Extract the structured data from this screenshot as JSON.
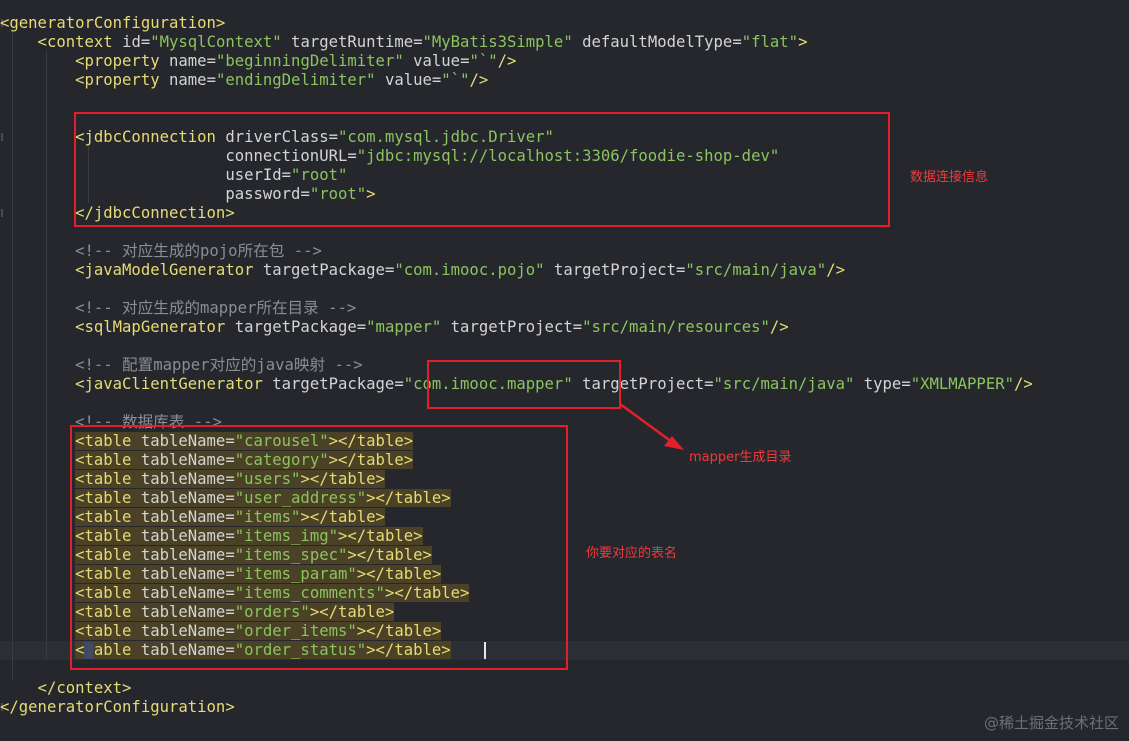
{
  "theme": {
    "tag": "#e6db74",
    "attr": "#d4d4d4",
    "value": "#8bc45e",
    "comment": "#8a8d94",
    "plain": "#d4d4d4",
    "highlight": "#4a4126",
    "annotation": "#e0212b"
  },
  "code_lines": [
    [
      {
        "t": "<generatorConfiguration>",
        "c": "tag"
      }
    ],
    [
      {
        "t": "    <context ",
        "c": "tag"
      },
      {
        "t": "id",
        "c": "attr"
      },
      {
        "t": "=",
        "c": "plain"
      },
      {
        "t": "\"MysqlContext\"",
        "c": "value"
      },
      {
        "t": " targetRuntime",
        "c": "attr"
      },
      {
        "t": "=",
        "c": "plain"
      },
      {
        "t": "\"MyBatis3Simple\"",
        "c": "value"
      },
      {
        "t": " defaultModelType",
        "c": "attr"
      },
      {
        "t": "=",
        "c": "plain"
      },
      {
        "t": "\"flat\"",
        "c": "value"
      },
      {
        "t": ">",
        "c": "tag"
      }
    ],
    [
      {
        "t": "        <property ",
        "c": "tag"
      },
      {
        "t": "name",
        "c": "attr"
      },
      {
        "t": "=",
        "c": "plain"
      },
      {
        "t": "\"beginningDelimiter\"",
        "c": "value"
      },
      {
        "t": " value",
        "c": "attr"
      },
      {
        "t": "=",
        "c": "plain"
      },
      {
        "t": "\"`\"",
        "c": "value"
      },
      {
        "t": "/>",
        "c": "tag"
      }
    ],
    [
      {
        "t": "        <property ",
        "c": "tag"
      },
      {
        "t": "name",
        "c": "attr"
      },
      {
        "t": "=",
        "c": "plain"
      },
      {
        "t": "\"endingDelimiter\"",
        "c": "value"
      },
      {
        "t": " value",
        "c": "attr"
      },
      {
        "t": "=",
        "c": "plain"
      },
      {
        "t": "\"`\"",
        "c": "value"
      },
      {
        "t": "/>",
        "c": "tag"
      }
    ],
    [],
    [],
    [
      {
        "t": "        <jdbcConnection ",
        "c": "tag"
      },
      {
        "t": "driverClass",
        "c": "attr"
      },
      {
        "t": "=",
        "c": "plain"
      },
      {
        "t": "\"com.mysql.jdbc.Driver\"",
        "c": "value"
      }
    ],
    [
      {
        "t": "                        connectionURL",
        "c": "attr"
      },
      {
        "t": "=",
        "c": "plain"
      },
      {
        "t": "\"jdbc:mysql://localhost:3306/foodie-shop-dev\"",
        "c": "value"
      }
    ],
    [
      {
        "t": "                        userId",
        "c": "attr"
      },
      {
        "t": "=",
        "c": "plain"
      },
      {
        "t": "\"root\"",
        "c": "value"
      }
    ],
    [
      {
        "t": "                        password",
        "c": "attr"
      },
      {
        "t": "=",
        "c": "plain"
      },
      {
        "t": "\"root\"",
        "c": "value"
      },
      {
        "t": ">",
        "c": "tag"
      }
    ],
    [
      {
        "t": "        </jdbcConnection>",
        "c": "tag"
      }
    ],
    [],
    [
      {
        "t": "        <!-- 对应生成的pojo所在包 -->",
        "c": "comment"
      }
    ],
    [
      {
        "t": "        <javaModelGenerator ",
        "c": "tag"
      },
      {
        "t": "targetPackage",
        "c": "attr"
      },
      {
        "t": "=",
        "c": "plain"
      },
      {
        "t": "\"com.imooc.pojo\"",
        "c": "value"
      },
      {
        "t": " targetProject",
        "c": "attr"
      },
      {
        "t": "=",
        "c": "plain"
      },
      {
        "t": "\"src/main/java\"",
        "c": "value"
      },
      {
        "t": "/>",
        "c": "tag"
      }
    ],
    [],
    [
      {
        "t": "        <!-- 对应生成的mapper所在目录 -->",
        "c": "comment"
      }
    ],
    [
      {
        "t": "        <sqlMapGenerator ",
        "c": "tag"
      },
      {
        "t": "targetPackage",
        "c": "attr"
      },
      {
        "t": "=",
        "c": "plain"
      },
      {
        "t": "\"mapper\"",
        "c": "value"
      },
      {
        "t": " targetProject",
        "c": "attr"
      },
      {
        "t": "=",
        "c": "plain"
      },
      {
        "t": "\"src/main/resources\"",
        "c": "value"
      },
      {
        "t": "/>",
        "c": "tag"
      }
    ],
    [],
    [
      {
        "t": "        <!-- 配置mapper对应的java映射 -->",
        "c": "comment"
      }
    ],
    [
      {
        "t": "        <javaClientGenerator ",
        "c": "tag"
      },
      {
        "t": "targetPackage",
        "c": "attr"
      },
      {
        "t": "=",
        "c": "plain"
      },
      {
        "t": "\"com.imooc.mapper\"",
        "c": "value"
      },
      {
        "t": " targetProject",
        "c": "attr"
      },
      {
        "t": "=",
        "c": "plain"
      },
      {
        "t": "\"src/main/java\"",
        "c": "value"
      },
      {
        "t": " type",
        "c": "attr"
      },
      {
        "t": "=",
        "c": "plain"
      },
      {
        "t": "\"XMLMAPPER\"",
        "c": "value"
      },
      {
        "t": "/>",
        "c": "tag"
      }
    ],
    [],
    [
      {
        "t": "        <!-- 数据库表 -->",
        "c": "comment"
      }
    ],
    [
      {
        "t": "        ",
        "c": "plain"
      },
      {
        "t": "<table ",
        "c": "tag",
        "h": true
      },
      {
        "t": "tableName",
        "c": "attr",
        "h": true
      },
      {
        "t": "=",
        "c": "plain",
        "h": true
      },
      {
        "t": "\"carousel\"",
        "c": "value",
        "h": true
      },
      {
        "t": "></table>",
        "c": "tag",
        "h": true
      }
    ],
    [
      {
        "t": "        ",
        "c": "plain"
      },
      {
        "t": "<table ",
        "c": "tag",
        "h": true
      },
      {
        "t": "tableName",
        "c": "attr",
        "h": true
      },
      {
        "t": "=",
        "c": "plain",
        "h": true
      },
      {
        "t": "\"category\"",
        "c": "value",
        "h": true
      },
      {
        "t": "></table>",
        "c": "tag",
        "h": true
      }
    ],
    [
      {
        "t": "        ",
        "c": "plain"
      },
      {
        "t": "<table ",
        "c": "tag",
        "h": true
      },
      {
        "t": "tableName",
        "c": "attr",
        "h": true
      },
      {
        "t": "=",
        "c": "plain",
        "h": true
      },
      {
        "t": "\"users\"",
        "c": "value",
        "h": true
      },
      {
        "t": "></table>",
        "c": "tag",
        "h": true
      }
    ],
    [
      {
        "t": "        ",
        "c": "plain"
      },
      {
        "t": "<table ",
        "c": "tag",
        "h": true
      },
      {
        "t": "tableName",
        "c": "attr",
        "h": true
      },
      {
        "t": "=",
        "c": "plain",
        "h": true
      },
      {
        "t": "\"user_address\"",
        "c": "value",
        "h": true
      },
      {
        "t": "></table>",
        "c": "tag",
        "h": true
      }
    ],
    [
      {
        "t": "        ",
        "c": "plain"
      },
      {
        "t": "<table ",
        "c": "tag",
        "h": true
      },
      {
        "t": "tableName",
        "c": "attr",
        "h": true
      },
      {
        "t": "=",
        "c": "plain",
        "h": true
      },
      {
        "t": "\"items\"",
        "c": "value",
        "h": true
      },
      {
        "t": "></table>",
        "c": "tag",
        "h": true
      }
    ],
    [
      {
        "t": "        ",
        "c": "plain"
      },
      {
        "t": "<table ",
        "c": "tag",
        "h": true
      },
      {
        "t": "tableName",
        "c": "attr",
        "h": true
      },
      {
        "t": "=",
        "c": "plain",
        "h": true
      },
      {
        "t": "\"items_img\"",
        "c": "value",
        "h": true
      },
      {
        "t": "></table>",
        "c": "tag",
        "h": true
      }
    ],
    [
      {
        "t": "        ",
        "c": "plain"
      },
      {
        "t": "<table ",
        "c": "tag",
        "h": true
      },
      {
        "t": "tableName",
        "c": "attr",
        "h": true
      },
      {
        "t": "=",
        "c": "plain",
        "h": true
      },
      {
        "t": "\"items_spec\"",
        "c": "value",
        "h": true
      },
      {
        "t": "></table>",
        "c": "tag",
        "h": true
      }
    ],
    [
      {
        "t": "        ",
        "c": "plain"
      },
      {
        "t": "<table ",
        "c": "tag",
        "h": true
      },
      {
        "t": "tableName",
        "c": "attr",
        "h": true
      },
      {
        "t": "=",
        "c": "plain",
        "h": true
      },
      {
        "t": "\"items_param\"",
        "c": "value",
        "h": true
      },
      {
        "t": "></table>",
        "c": "tag",
        "h": true
      }
    ],
    [
      {
        "t": "        ",
        "c": "plain"
      },
      {
        "t": "<table ",
        "c": "tag",
        "h": true
      },
      {
        "t": "tableName",
        "c": "attr",
        "h": true
      },
      {
        "t": "=",
        "c": "plain",
        "h": true
      },
      {
        "t": "\"items_comments\"",
        "c": "value",
        "h": true
      },
      {
        "t": "></table>",
        "c": "tag",
        "h": true
      }
    ],
    [
      {
        "t": "        ",
        "c": "plain"
      },
      {
        "t": "<table ",
        "c": "tag",
        "h": true
      },
      {
        "t": "tableName",
        "c": "attr",
        "h": true
      },
      {
        "t": "=",
        "c": "plain",
        "h": true
      },
      {
        "t": "\"orders\"",
        "c": "value",
        "h": true
      },
      {
        "t": "></table>",
        "c": "tag",
        "h": true
      }
    ],
    [
      {
        "t": "        ",
        "c": "plain"
      },
      {
        "t": "<table ",
        "c": "tag",
        "h": true
      },
      {
        "t": "tableName",
        "c": "attr",
        "h": true
      },
      {
        "t": "=",
        "c": "plain",
        "h": true
      },
      {
        "t": "\"order_items\"",
        "c": "value",
        "h": true
      },
      {
        "t": "></table>",
        "c": "tag",
        "h": true
      }
    ],
    [
      {
        "t": "        ",
        "c": "plain"
      },
      {
        "t": "<table ",
        "c": "tag",
        "h": true
      },
      {
        "t": "tableName",
        "c": "attr",
        "h": true
      },
      {
        "t": "=",
        "c": "plain",
        "h": true
      },
      {
        "t": "\"order_status\"",
        "c": "value",
        "h": true
      },
      {
        "t": "></table>",
        "c": "tag",
        "h": true
      }
    ],
    [],
    [
      {
        "t": "    </context>",
        "c": "tag"
      }
    ],
    [
      {
        "t": "</generatorConfiguration>",
        "c": "tag"
      }
    ]
  ],
  "annotations": {
    "jdbc": "数据连接信息",
    "mapper": "mapper生成目录",
    "tables": "你要对应的表名"
  },
  "watermark": "@稀土掘金技术社区"
}
